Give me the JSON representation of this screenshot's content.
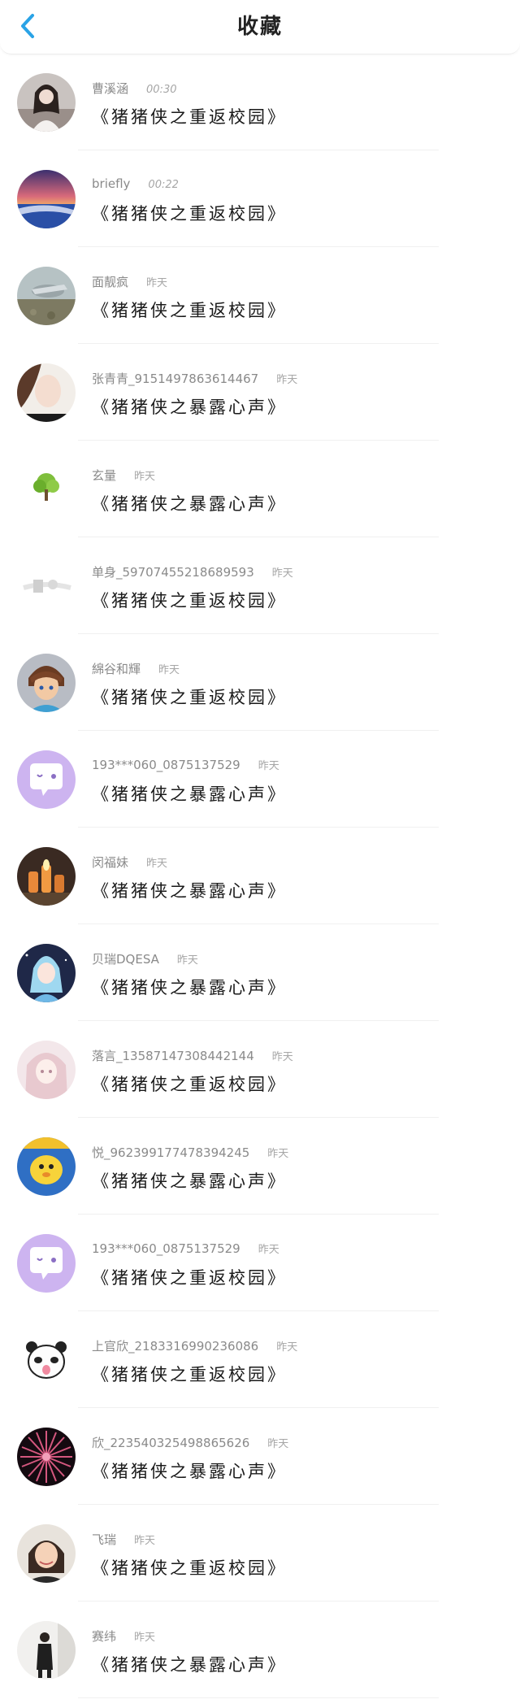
{
  "header": {
    "title": "收藏",
    "back_icon": "chevron-left-icon",
    "accent": "#2aa3e6"
  },
  "items": [
    {
      "name": "曹溪涵",
      "time": "00:30",
      "work": "《猪猪侠之重返校园》",
      "avatar": "photo-girl"
    },
    {
      "name": "briefly",
      "time": "00:22",
      "work": "《猪猪侠之重返校园》",
      "avatar": "photo-sunset"
    },
    {
      "name": "面靓疯",
      "time": "昨天",
      "work": "《猪猪侠之重返校园》",
      "avatar": "photo-bird"
    },
    {
      "name": "张青青_9151497863614467",
      "time": "昨天",
      "work": "《猪猪侠之暴露心声》",
      "avatar": "photo-face"
    },
    {
      "name": "玄量",
      "time": "昨天",
      "work": "《猪猪侠之暴露心声》",
      "avatar": "tree-icon"
    },
    {
      "name": "单身_59707455218689593",
      "time": "昨天",
      "work": "《猪猪侠之重返校园》",
      "avatar": "photo-faded"
    },
    {
      "name": "綿谷和輝",
      "time": "昨天",
      "work": "《猪猪侠之重返校园》",
      "avatar": "anime-boy"
    },
    {
      "name": "193***060_0875137529",
      "time": "昨天",
      "work": "《猪猪侠之暴露心声》",
      "avatar": "chat-bubble-icon"
    },
    {
      "name": "闵福妹",
      "time": "昨天",
      "work": "《猪猪侠之暴露心声》",
      "avatar": "photo-candles"
    },
    {
      "name": "贝瑞DQESA",
      "time": "昨天",
      "work": "《猪猪侠之暴露心声》",
      "avatar": "anime-girl-blue"
    },
    {
      "name": "落言_13587147308442144",
      "time": "昨天",
      "work": "《猪猪侠之重返校园》",
      "avatar": "anime-girl-pink"
    },
    {
      "name": "悦_9623991774783942​45",
      "time": "昨天",
      "work": "《猪猪侠之暴露心声》",
      "avatar": "cartoon-yellow"
    },
    {
      "name": "193***060_0875137529",
      "time": "昨天",
      "work": "《猪猪侠之重返校园》",
      "avatar": "chat-bubble-icon"
    },
    {
      "name": "上官欣_2183316990236086",
      "time": "昨天",
      "work": "《猪猪侠之重返校园》",
      "avatar": "panda-cartoon"
    },
    {
      "name": "欣_22354032549886​5626",
      "time": "昨天",
      "work": "《猪猪侠之暴露心声》",
      "avatar": "burst-dark"
    },
    {
      "name": "飞瑞",
      "time": "昨天",
      "work": "《猪猪侠之重返校园》",
      "avatar": "photo-woman"
    },
    {
      "name": "赛纬",
      "time": "昨天",
      "work": "《猪猪侠之暴露心声》",
      "avatar": "photo-standing"
    }
  ]
}
